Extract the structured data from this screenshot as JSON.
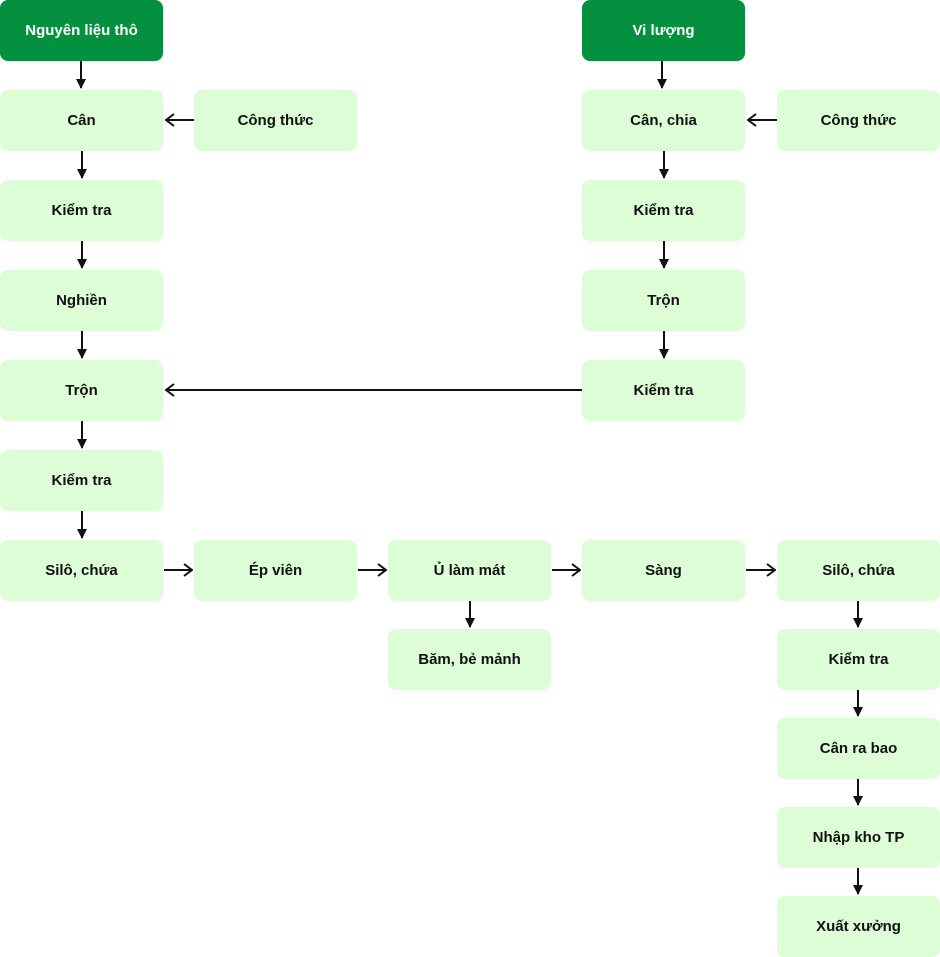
{
  "colors": {
    "start_node": "#039140",
    "step_node": "#ddfdd7",
    "arrow": "#111111"
  },
  "left_branch": {
    "start": "Nguyên liệu thô",
    "weigh": "Cân",
    "recipe": "Công thức",
    "check1": "Kiểm tra",
    "grind": "Nghiền",
    "mix": "Trộn",
    "check2": "Kiểm tra",
    "silo": "Silô, chứa"
  },
  "right_branch": {
    "start": "Vi lượng",
    "weigh": "Cân, chia",
    "recipe": "Công thức",
    "check1": "Kiểm tra",
    "mix": "Trộn",
    "check2": "Kiểm tra"
  },
  "process": {
    "pellet": "Ép viên",
    "cool": "Ủ làm mát",
    "crumble": "Băm, bẻ mảnh",
    "screen": "Sàng",
    "silo": "Silô, chứa",
    "check": "Kiểm tra",
    "bagging": "Cân ra bao",
    "warehouse": "Nhập kho TP",
    "dispatch": "Xuất xưởng"
  }
}
